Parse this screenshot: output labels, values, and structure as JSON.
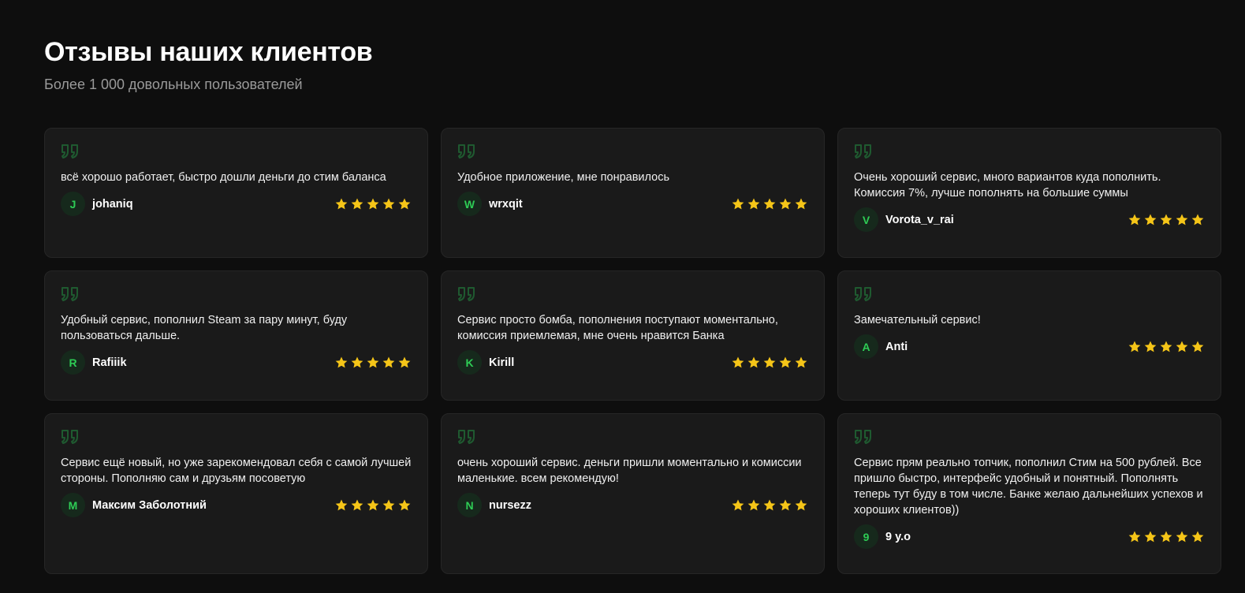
{
  "header": {
    "title": "Отзывы наших клиентов",
    "subtitle": "Более 1 000 довольных пользователей"
  },
  "colors": {
    "background": "#0e0e0e",
    "card": "#1a1a1a",
    "accent_green": "#2ecc55",
    "star_yellow": "#f5c518"
  },
  "reviews": [
    {
      "text": "всё хорошо работает, быстро дошли деньги до стим баланса",
      "initial": "J",
      "author": "johaniq",
      "rating": 5
    },
    {
      "text": "Удобное приложение, мне понравилось",
      "initial": "W",
      "author": "wrxqit",
      "rating": 5
    },
    {
      "text": "Очень хороший сервис, много вариантов куда пополнить. Комиссия 7%, лучше пополнять на большие суммы",
      "initial": "V",
      "author": "Vorota_v_rai",
      "rating": 5
    },
    {
      "text": "Удобный сервис, пополнил Steam за пару минут, буду пользоваться дальше.",
      "initial": "R",
      "author": "Rafiiik",
      "rating": 5
    },
    {
      "text": "Сервис просто бомба, пополнения поступают моментально, комиссия приемлемая, мне очень нравится Банка",
      "initial": "K",
      "author": "Kirill",
      "rating": 5
    },
    {
      "text": "Замечательный сервис!",
      "initial": "A",
      "author": "Anti",
      "rating": 5
    },
    {
      "text": "Сервис ещё новый, но уже зарекомендовал себя с самой лучшей стороны. Пополняю сам и друзьям посоветую",
      "initial": "M",
      "author": "Максим Заболотний",
      "rating": 5
    },
    {
      "text": "очень хороший сервис. деньги пришли моментально и комиссии маленькие. всем рекомендую!",
      "initial": "N",
      "author": "nursezz",
      "rating": 5
    },
    {
      "text": "Сервис прям реально топчик, пополнил Стим на 500 рублей. Все пришло быстро, интерфейс удобный и понятный. Пополнять теперь тут буду в том числе. Банке желаю дальнейших успехов и хороших клиентов))",
      "initial": "9",
      "author": "9 y.o",
      "rating": 5
    }
  ]
}
